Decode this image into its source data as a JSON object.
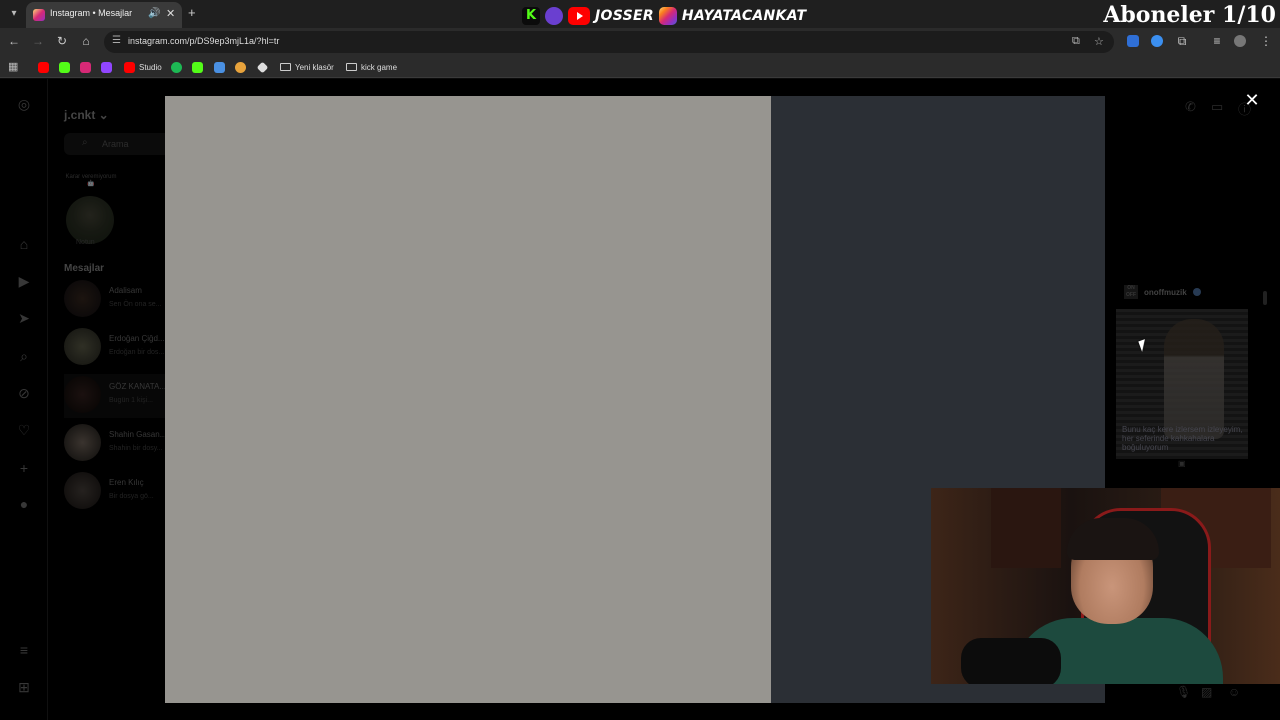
{
  "browser": {
    "tab_title": "Instagram • Mesajlar",
    "tab_icon": "instagram-icon",
    "url": "instagram.com/p/DS9ep3mjL1a/?hl=tr",
    "bookmarks": [
      {
        "label": "",
        "icon": "youtube-icon",
        "color": "#ff0000"
      },
      {
        "label": "",
        "icon": "kick-icon",
        "color": "#53fc18"
      },
      {
        "label": "",
        "icon": "instagram-icon",
        "color": "#d62976"
      },
      {
        "label": "",
        "icon": "twitch-icon",
        "color": "#9146ff"
      },
      {
        "label": "Studio",
        "icon": "youtube-studio-icon",
        "color": "#ff0000"
      },
      {
        "label": "",
        "icon": "spotify-icon",
        "color": "#1db954"
      },
      {
        "label": "",
        "icon": "kick-icon",
        "color": "#53fc18"
      },
      {
        "label": "",
        "icon": "edit-icon",
        "color": "#4a90e2"
      },
      {
        "label": "",
        "icon": "game-icon",
        "color": "#e8a33c"
      },
      {
        "label": "",
        "icon": "diamond-icon",
        "color": "#dddddd"
      },
      {
        "label": "Yeni klasör",
        "icon": "folder-icon",
        "color": "#cccccc"
      },
      {
        "label": "kick game",
        "icon": "folder-icon",
        "color": "#cccccc"
      }
    ]
  },
  "stream_overlay": {
    "brand": "JOSSER",
    "handle": "HAYATACANKAT",
    "subscribers": "Aboneler 1/10"
  },
  "instagram": {
    "username": "j.cnkt",
    "search_placeholder": "Arama",
    "note_text": "Karar veremiyorum 🤖",
    "note_label": "Notun",
    "messages_heading": "Mesajlar",
    "conversations": [
      {
        "name": "Adalisam",
        "preview": "Sen Ön ona se..."
      },
      {
        "name": "Erdoğan Çiğd...",
        "preview": "Erdoğan bir dos..."
      },
      {
        "name": "GÖZ KANATA...",
        "preview": "Bugün 1 kişi..."
      },
      {
        "name": "Shahin Gasan...",
        "preview": "Shahin bir dosy..."
      },
      {
        "name": "Eren Kılıç",
        "preview": "Bir dosya gö..."
      }
    ],
    "reel": {
      "username": "onoffmuzik",
      "logo": "ON OFF",
      "caption": "Bunu kaç kere izlersem izleyeyim, her seferinde kahkahalara boğuluyorum"
    }
  },
  "modal": {
    "close_label": "✕"
  }
}
